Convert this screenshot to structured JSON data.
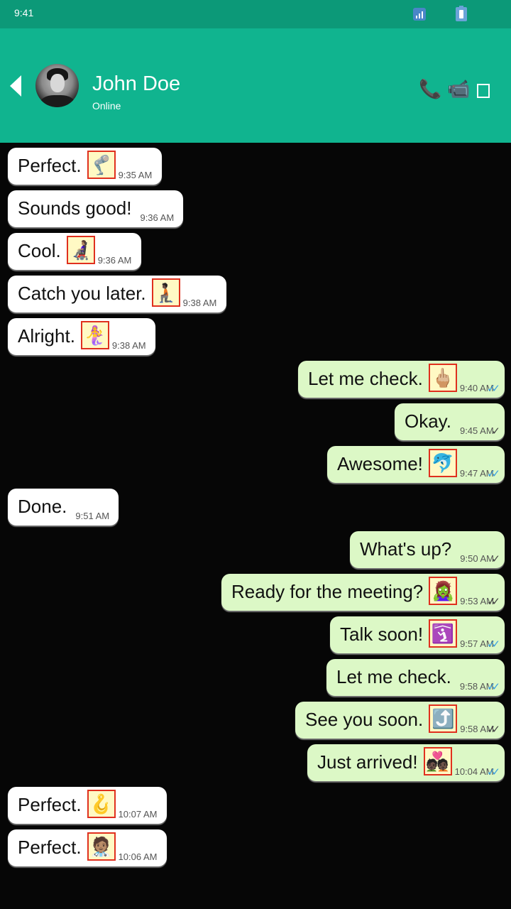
{
  "status_bar": {
    "time": "9:41"
  },
  "header": {
    "name": "John Doe",
    "status": "Online",
    "icons": [
      "back-arrow-icon",
      "phone-icon",
      "video-camera-icon",
      "more-options-icon"
    ]
  },
  "colors": {
    "header": "#10b48f",
    "status_bar": "#0c9978",
    "incoming_bubble": "#ffffff",
    "outgoing_bubble": "#dcf8c6",
    "read_tick": "#3a9fe0"
  },
  "messages": [
    {
      "dir": "in",
      "text": "Perfect.",
      "emoji": "🦿",
      "time": "9:35 AM"
    },
    {
      "dir": "in",
      "text": "Sounds good!",
      "emoji": "",
      "time": "9:36 AM"
    },
    {
      "dir": "in",
      "text": "Cool.",
      "emoji": "👩🏽‍🦼",
      "time": "9:36 AM"
    },
    {
      "dir": "in",
      "text": "Catch you later.",
      "emoji": "🧎🏿",
      "time": "9:38 AM"
    },
    {
      "dir": "in",
      "text": "Alright.",
      "emoji": "🧜‍♀️",
      "time": "9:38 AM"
    },
    {
      "dir": "out",
      "text": "Let me check.",
      "emoji": "🖕🏼",
      "time": "9:40 AM",
      "status": "read"
    },
    {
      "dir": "out",
      "text": "Okay.",
      "emoji": "",
      "time": "9:45 AM",
      "status": "sent"
    },
    {
      "dir": "out",
      "text": "Awesome!",
      "emoji": "🐬",
      "time": "9:47 AM",
      "status": "read"
    },
    {
      "dir": "in",
      "text": "Done.",
      "emoji": "",
      "time": "9:51 AM"
    },
    {
      "dir": "out",
      "text": "What's up?",
      "emoji": "",
      "time": "9:50 AM",
      "status": "sent"
    },
    {
      "dir": "out",
      "text": "Ready for the meeting?",
      "emoji": "🧟‍♀️",
      "time": "9:53 AM",
      "status": "delivered"
    },
    {
      "dir": "out",
      "text": "Talk soon!",
      "emoji": "🛐",
      "time": "9:57 AM",
      "status": "read"
    },
    {
      "dir": "out",
      "text": "Let me check.",
      "emoji": "",
      "time": "9:58 AM",
      "status": "read"
    },
    {
      "dir": "out",
      "text": "See you soon.",
      "emoji": "⤴️",
      "time": "9:58 AM",
      "status": "delivered"
    },
    {
      "dir": "out",
      "text": "Just arrived!",
      "emoji": "💑🏿",
      "time": "10:04 AM",
      "status": "read"
    },
    {
      "dir": "in",
      "text": "Perfect.",
      "emoji": "🪝",
      "time": "10:07 AM"
    },
    {
      "dir": "in",
      "text": "Perfect.",
      "emoji": "🧑🏽‍⚕️",
      "time": "10:06 AM"
    }
  ]
}
